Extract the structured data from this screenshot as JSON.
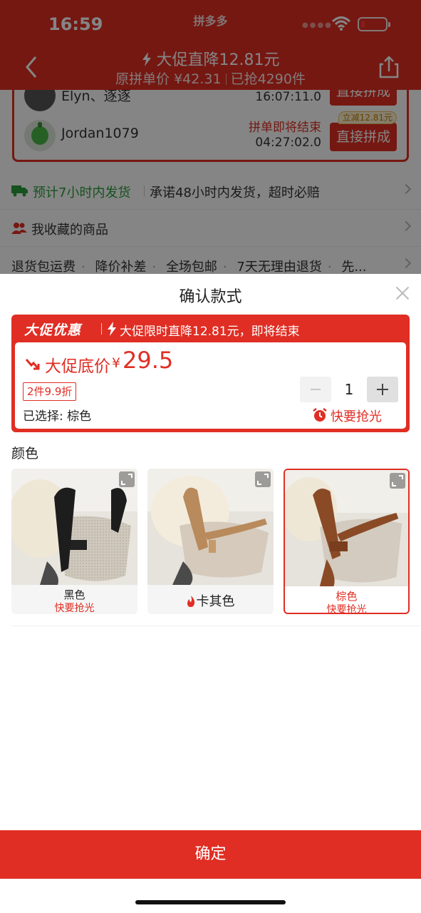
{
  "status_bar": {
    "time": "16:59",
    "app_name": "拼多多",
    "battery_color": "#ff3b30"
  },
  "nav": {
    "title": "大促直降12.81元",
    "original_price": "原拼单价 ¥42.31",
    "sold": "已抢4290件",
    "back_icon": "chevron-left-icon",
    "share_icon": "share-icon"
  },
  "group_buy": [
    {
      "name": "Elyn、逐逐",
      "status": "",
      "timer": "16:07:11.0",
      "join_label": "直接拼成",
      "tag": ""
    },
    {
      "name": "Jordan1079",
      "status": "拼单即将结束",
      "timer": "04:27:02.0",
      "join_label": "直接拼成",
      "tag": "立减12.81元"
    }
  ],
  "shipping": {
    "estimate": "预计7小时内发货",
    "promise": "承诺48小时内发货，超时必赔"
  },
  "favorites": {
    "label": "我收藏的商品"
  },
  "services": [
    "退货包运费",
    "降价补差",
    "全场包邮",
    "7天无理由退货",
    "先..."
  ],
  "sheet": {
    "title": "确认款式",
    "promo": {
      "brand": "大促优惠",
      "message": "大促限时直降12.81元，即将结束",
      "price_label": "大促底价",
      "currency": "¥",
      "price": "29.5",
      "discount": "2件9.9折",
      "selected": "已选择: 棕色",
      "quantity": "1",
      "hot": "快要抢光"
    },
    "color_section": "颜色",
    "colors": [
      {
        "name": "黑色",
        "sub": "快要抢光",
        "selected": false
      },
      {
        "name": "卡其色",
        "sub": "",
        "selected": false,
        "hot_icon": "fire-icon"
      },
      {
        "name": "棕色",
        "sub": "快要抢光",
        "selected": true
      }
    ],
    "confirm_label": "确定"
  },
  "colors": {
    "brand_red": "#e02e24",
    "ship_green": "#2a9d3a"
  }
}
